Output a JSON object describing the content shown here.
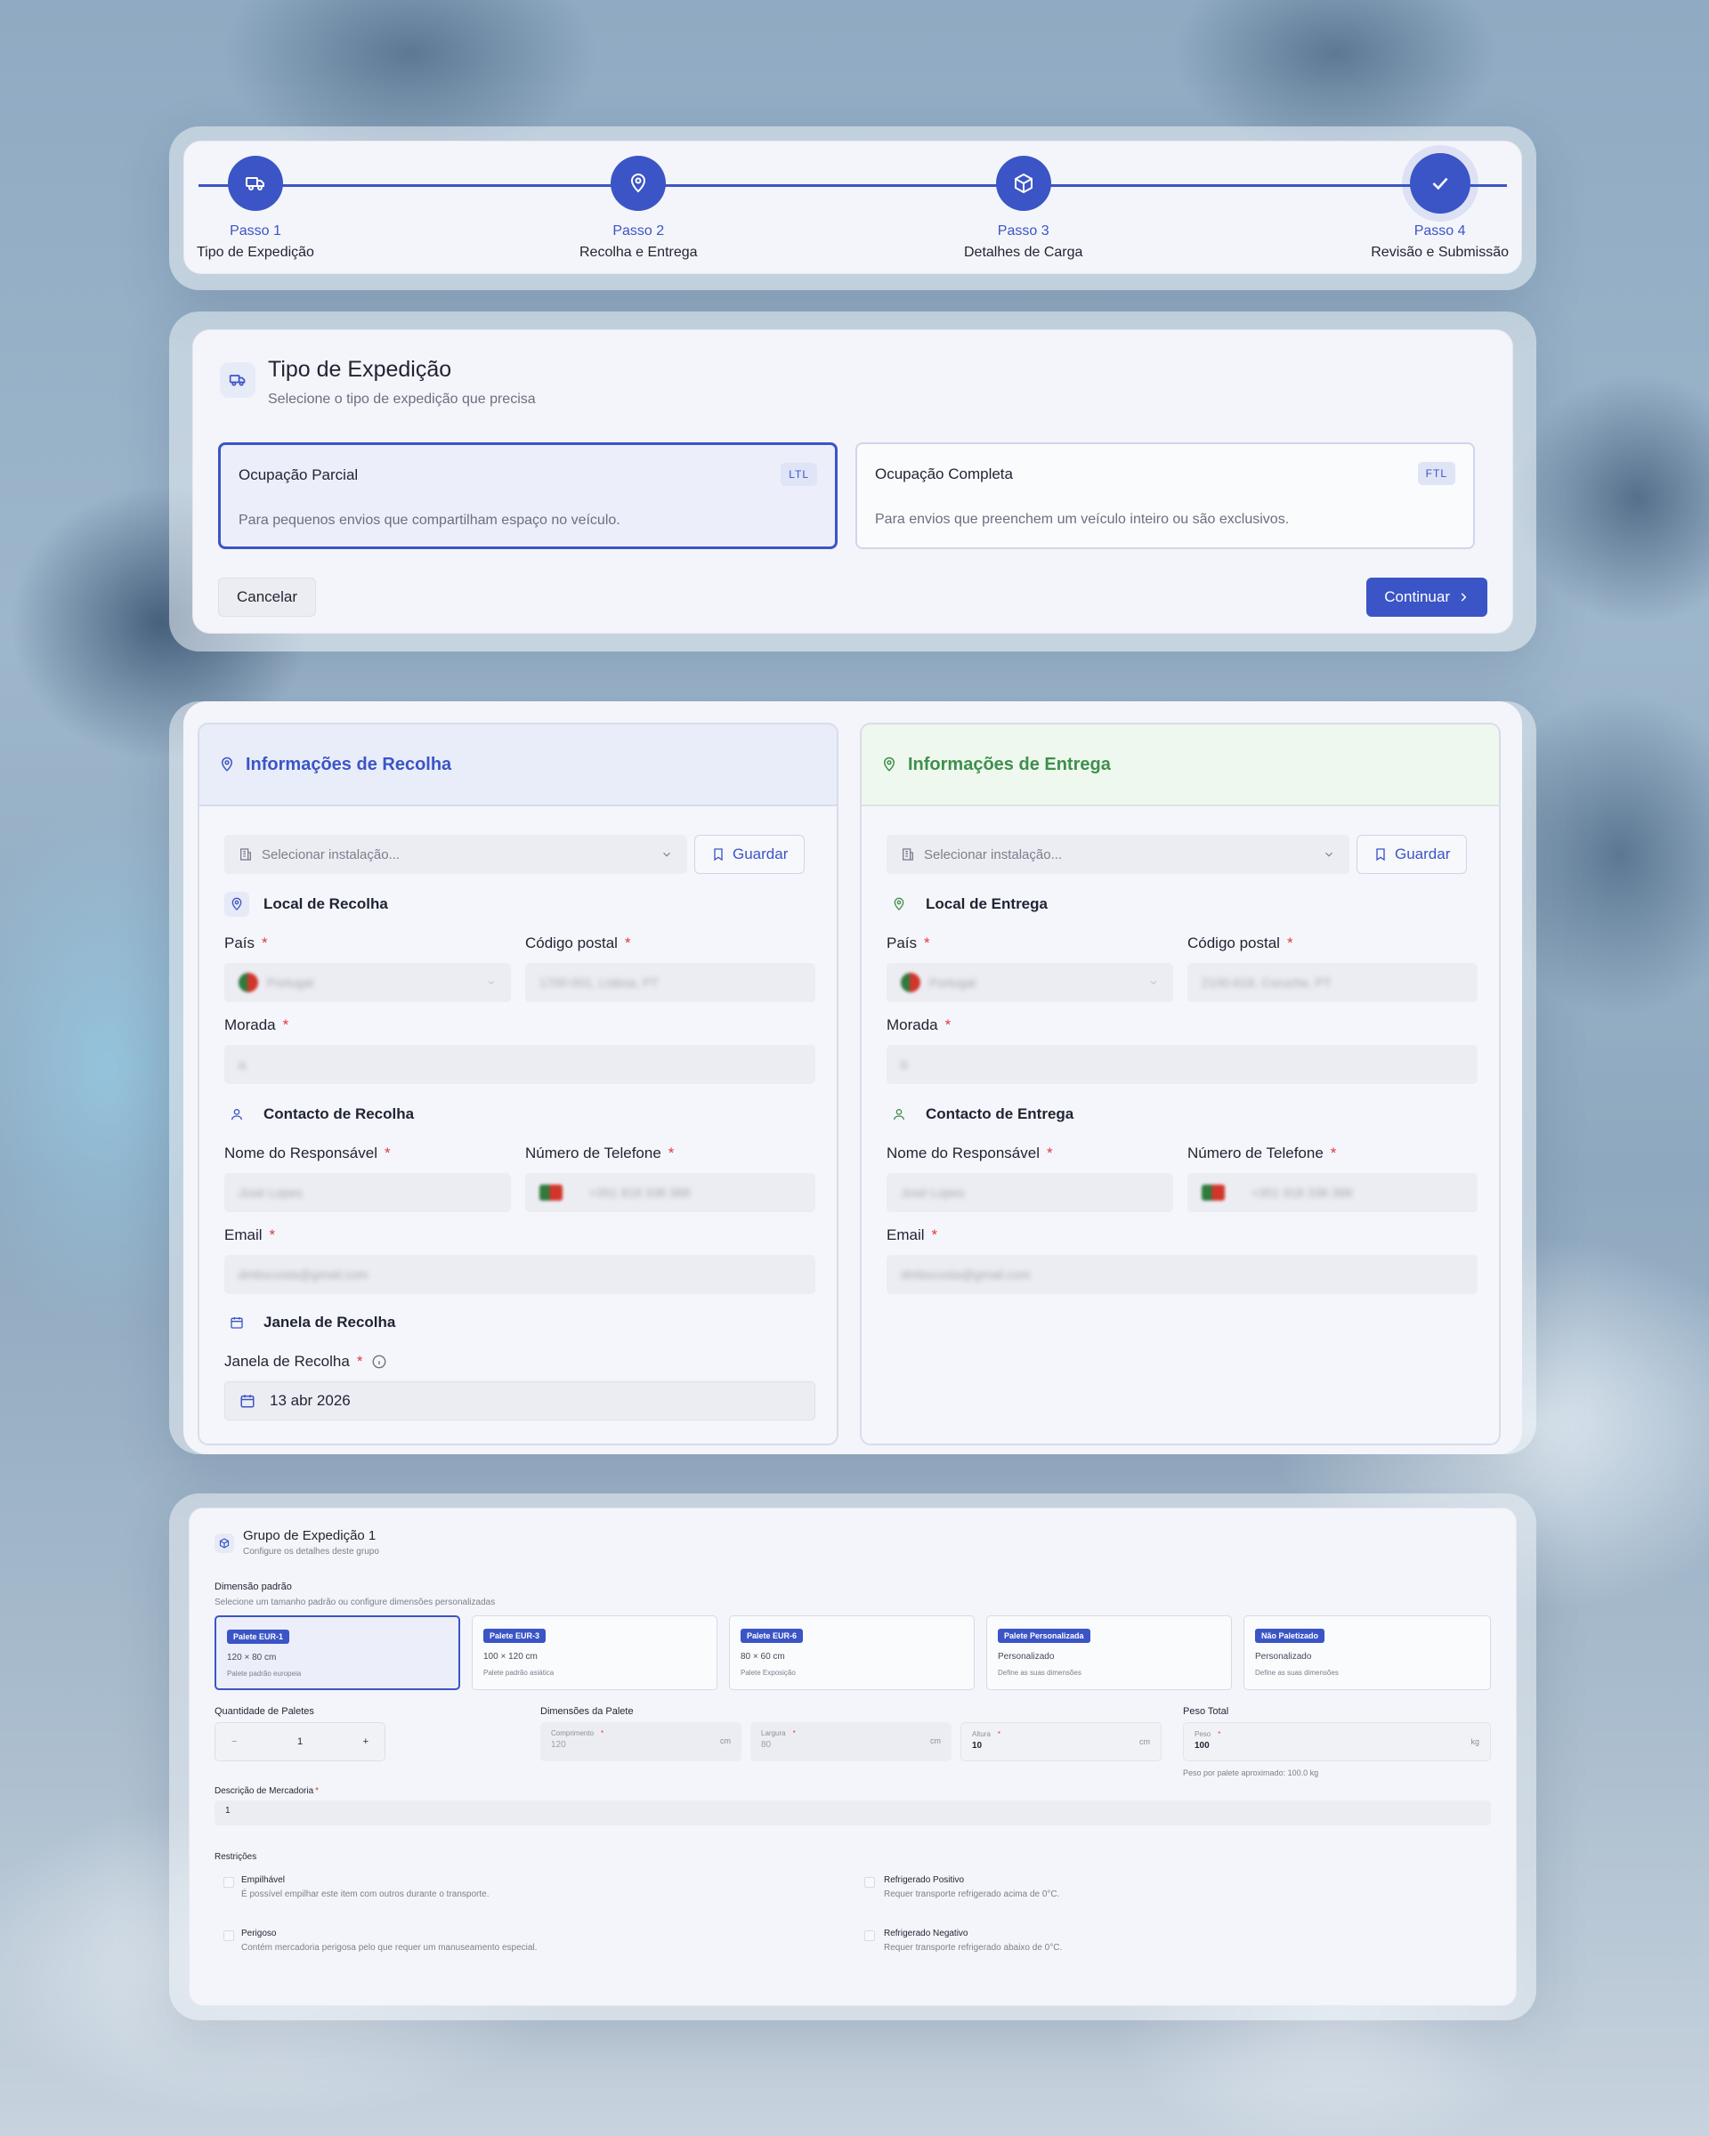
{
  "stepper": {
    "steps": [
      {
        "num": "Passo 1",
        "label": "Tipo de Expedição",
        "icon": "truck-icon"
      },
      {
        "num": "Passo 2",
        "label": "Recolha e Entrega",
        "icon": "map-pin-icon"
      },
      {
        "num": "Passo 3",
        "label": "Detalhes de Carga",
        "icon": "package-icon"
      },
      {
        "num": "Passo 4",
        "label": "Revisão e Submissão",
        "icon": "check-icon"
      }
    ],
    "active_step": 4
  },
  "tipo": {
    "title": "Tipo de Expedição",
    "subtitle": "Selecione o tipo de expedição que precisa",
    "options": [
      {
        "title": "Ocupação Parcial",
        "badge": "LTL",
        "desc": "Para pequenos envios que compartilham espaço no veículo.",
        "selected": true
      },
      {
        "title": "Ocupação Completa",
        "badge": "FTL",
        "desc": "Para envios que preenchem um veículo inteiro ou são exclusivos.",
        "selected": false
      }
    ],
    "cancel_label": "Cancelar",
    "continue_label": "Continuar"
  },
  "recolha": {
    "title": "Informações de Recolha",
    "facility_placeholder": "Selecionar instalação...",
    "save_label": "Guardar",
    "local_title": "Local de Recolha",
    "pais_label": "País",
    "pais_value": "Portugal",
    "cp_label": "Código postal",
    "cp_value": "1700-001, Lisboa, PT",
    "morada_label": "Morada",
    "morada_value": "a",
    "contact_title": "Contacto de Recolha",
    "nome_label": "Nome do Responsável",
    "nome_value": "José Lopes",
    "tel_label": "Número de Telefone",
    "tel_value": "+351 918 338 388",
    "email_label": "Email",
    "email_value": "dmbscosta@gmail.com",
    "janela_title": "Janela de Recolha",
    "janela_label": "Janela de Recolha",
    "janela_value": "13 abr 2026"
  },
  "entrega": {
    "title": "Informações de Entrega",
    "facility_placeholder": "Selecionar instalação...",
    "save_label": "Guardar",
    "local_title": "Local de Entrega",
    "pais_label": "País",
    "pais_value": "Portugal",
    "cp_label": "Código postal",
    "cp_value": "2100-618, Coruche, PT",
    "morada_label": "Morada",
    "morada_value": "b",
    "contact_title": "Contacto de Entrega",
    "nome_label": "Nome do Responsável",
    "nome_value": "José Lopes",
    "tel_label": "Número de Telefone",
    "tel_value": "+351 918 338 388",
    "email_label": "Email",
    "email_value": "dmbscosta@gmail.com"
  },
  "grupo": {
    "title": "Grupo de Expedição 1",
    "subtitle": "Configure os detalhes deste grupo",
    "dim_title": "Dimensão padrão",
    "dim_subtitle": "Selecione um tamanho padrão ou configure dimensões personalizadas",
    "dims": [
      {
        "badge": "Palete EUR-1",
        "size": "120 × 80 cm",
        "desc": "Palete padrão europeia",
        "selected": true
      },
      {
        "badge": "Palete EUR-3",
        "size": "100 × 120 cm",
        "desc": "Palete padrão asiática",
        "selected": false
      },
      {
        "badge": "Palete EUR-6",
        "size": "80 × 60 cm",
        "desc": "Palete Exposição",
        "selected": false
      },
      {
        "badge": "Palete Personalizada",
        "size": "Personalizado",
        "desc": "Define as suas dimensões",
        "selected": false
      },
      {
        "badge": "Não Paletizado",
        "size": "Personalizado",
        "desc": "Define as suas dimensões",
        "selected": false
      }
    ],
    "qty_label": "Quantidade de Paletes",
    "qty_value": "1",
    "minus": "−",
    "plus": "+",
    "pal_dim_label": "Dimensões da Palete",
    "comp_label": "Comprimento",
    "comp_value": "120",
    "larg_label": "Largura",
    "larg_value": "80",
    "alt_label": "Altura",
    "alt_value": "10",
    "unit_cm": "cm",
    "peso_total_label": "Peso Total",
    "peso_label": "Peso",
    "peso_value": "100",
    "unit_kg": "kg",
    "peso_hint": "Peso por palete aproximado: 100.0 kg",
    "desc_label": "Descrição de Mercadoria",
    "desc_value": "1",
    "restr_title": "Restrições",
    "restr": [
      {
        "title": "Empilhável",
        "desc": "É possível empilhar este item com outros durante o transporte."
      },
      {
        "title": "Refrigerado Positivo",
        "desc": "Requer transporte refrigerado acima de 0°C."
      },
      {
        "title": "Perigoso",
        "desc": "Contém mercadoria perigosa pelo que requer um manuseamento especial."
      },
      {
        "title": "Refrigerado Negativo",
        "desc": "Requer transporte refrigerado abaixo de 0°C."
      }
    ]
  },
  "colors": {
    "primary": "#3b55c6",
    "green": "#3f8f4c",
    "required": "#e03a3a"
  }
}
